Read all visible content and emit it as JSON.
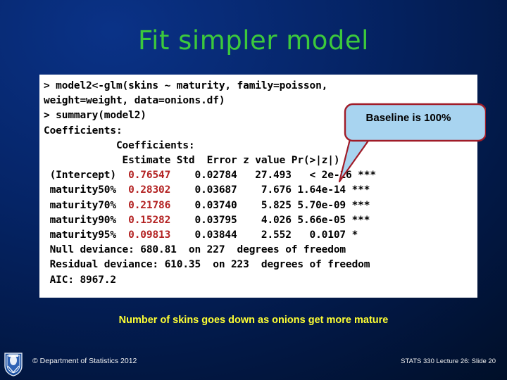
{
  "slide": {
    "title": "Fit simpler model",
    "subtitle": "Number of skins goes down as onions get more mature",
    "background_color": "#052466",
    "title_color": "#3cc93c",
    "subtitle_color": "#ffff33"
  },
  "callout": {
    "label": "Baseline is  100%",
    "fill_color": "#a8d4f0",
    "border_color": "#a01c28"
  },
  "code": {
    "panel_background": "#ffffff",
    "text_color": "#000000",
    "highlight_color": "#b32222",
    "lines": [
      {
        "id": "l1",
        "text": "> model2<-glm(skins ~ maturity, family=poisson,"
      },
      {
        "id": "l2",
        "text": "weight=weight, data=onions.df)"
      },
      {
        "id": "l3",
        "text": "> summary(model2)"
      },
      {
        "id": "l4",
        "text": "Coefficients:"
      },
      {
        "id": "l5",
        "text": "            Coefficients:"
      },
      {
        "id": "l6",
        "text": "             Estimate Std  Error z value Pr(>|z|)"
      },
      {
        "id": "l7a",
        "text": " (Intercept)  "
      },
      {
        "id": "l7b",
        "text": "0.76547"
      },
      {
        "id": "l7c",
        "text": "    0.02784   27.493   < 2e-16 ***"
      },
      {
        "id": "l8a",
        "text": " maturity50%  "
      },
      {
        "id": "l8b",
        "text": "0.28302"
      },
      {
        "id": "l8c",
        "text": "    0.03687    7.676 1.64e-14 ***"
      },
      {
        "id": "l9a",
        "text": " maturity70%  "
      },
      {
        "id": "l9b",
        "text": "0.21786"
      },
      {
        "id": "l9c",
        "text": "    0.03740    5.825 5.70e-09 ***"
      },
      {
        "id": "l10a",
        "text": " maturity90%  "
      },
      {
        "id": "l10b",
        "text": "0.15282"
      },
      {
        "id": "l10c",
        "text": "    0.03795    4.026 5.66e-05 ***"
      },
      {
        "id": "l11a",
        "text": " maturity95%  "
      },
      {
        "id": "l11b",
        "text": "0.09813"
      },
      {
        "id": "l11c",
        "text": "    0.03844    2.552   0.0107 *"
      },
      {
        "id": "l12",
        "text": " Null deviance: 680.81  on 227  degrees of freedom"
      },
      {
        "id": "l13",
        "text": " Residual deviance: 610.35  on 223  degrees of freedom"
      },
      {
        "id": "l14",
        "text": " AIC: 8967.2"
      }
    ]
  },
  "model_summary": {
    "call": "model2 <- glm(skins ~ maturity, family=poisson, weight=weight, data=onions.df)",
    "coefficient_headers": [
      "",
      "Estimate",
      "Std Error",
      "z value",
      "Pr(>|z|)",
      ""
    ],
    "coefficients": [
      {
        "term": "(Intercept)",
        "estimate": "0.76547",
        "std_error": "0.02784",
        "z_value": "27.493",
        "p_value": "< 2e-16",
        "signif": "***"
      },
      {
        "term": "maturity50%",
        "estimate": "0.28302",
        "std_error": "0.03687",
        "z_value": "7.676",
        "p_value": "1.64e-14",
        "signif": "***"
      },
      {
        "term": "maturity70%",
        "estimate": "0.21786",
        "std_error": "0.03740",
        "z_value": "5.825",
        "p_value": "5.70e-09",
        "signif": "***"
      },
      {
        "term": "maturity90%",
        "estimate": "0.15282",
        "std_error": "0.03795",
        "z_value": "4.026",
        "p_value": "5.66e-05",
        "signif": "***"
      },
      {
        "term": "maturity95%",
        "estimate": "0.09813",
        "std_error": "0.03844",
        "z_value": "2.552",
        "p_value": "0.0107",
        "signif": "*"
      }
    ],
    "null_deviance": "680.81",
    "null_df": "227",
    "residual_deviance": "610.35",
    "residual_df": "223",
    "aic": "8967.2"
  },
  "footer": {
    "copyright": "© Department of Statistics 2012",
    "slide_reference": "STATS 330 Lecture 26: Slide 20",
    "logo": "university-crest-icon"
  }
}
